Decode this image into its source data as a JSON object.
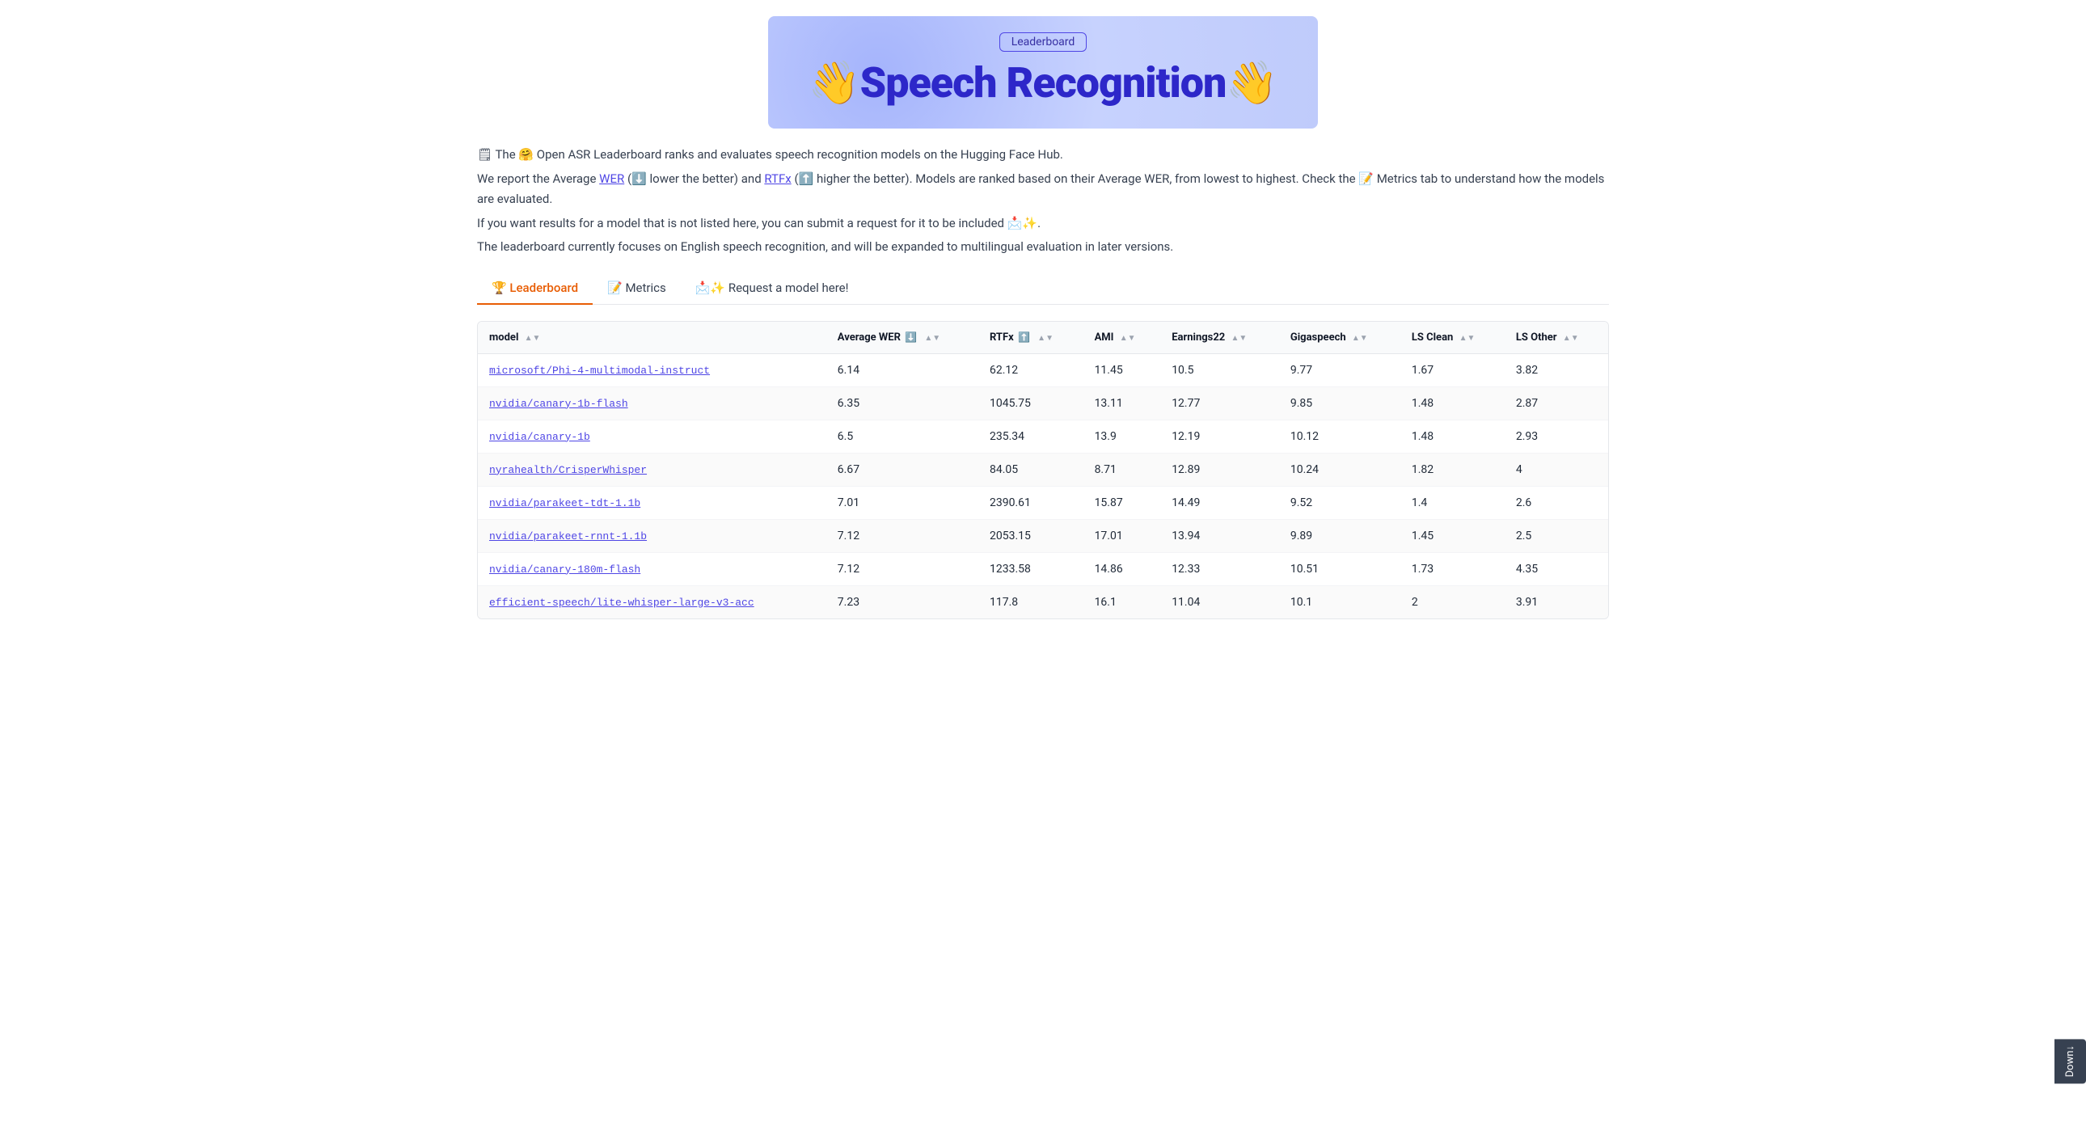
{
  "banner": {
    "button_label": "Leaderboard",
    "title_emoji_left": "👋",
    "title": "Speech Recognition",
    "title_emoji_right": "👋"
  },
  "description": {
    "line1": "🤗 Open ASR Leaderboard ranks and evaluates speech recognition models on the Hugging Face Hub.",
    "line2_prefix": "We report the Average ",
    "wer_link": "WER",
    "line2_mid1": " (⬇️ lower the better) and ",
    "rtfx_link": "RTFx",
    "line2_mid2": " (⬆️ higher the better). Models are ranked based on their Average WER, from lowest to highest. Check the 📝 Metrics tab to understand how the models are evaluated.",
    "line3": "If you want results for a model that is not listed here, you can submit a request for it to be included 📩✨.",
    "line4": "The leaderboard currently focuses on English speech recognition, and will be expanded to multilingual evaluation in later versions."
  },
  "tabs": [
    {
      "id": "leaderboard",
      "label": "🏆 Leaderboard",
      "active": true
    },
    {
      "id": "metrics",
      "label": "📝 Metrics",
      "active": false
    },
    {
      "id": "request",
      "label": "📩✨ Request a model here!",
      "active": false
    }
  ],
  "table": {
    "columns": [
      {
        "id": "model",
        "label": "model",
        "has_sort": true
      },
      {
        "id": "avg_wer",
        "label": "Average WER",
        "icon": "⬇️",
        "has_sort": true
      },
      {
        "id": "rtfx",
        "label": "RTFx",
        "icon": "⬆️",
        "has_sort": true
      },
      {
        "id": "ami",
        "label": "AMI",
        "has_sort": true
      },
      {
        "id": "earnings22",
        "label": "Earnings22",
        "has_sort": true
      },
      {
        "id": "gigaspeech",
        "label": "Gigaspeech",
        "has_sort": true
      },
      {
        "id": "ls_clean",
        "label": "LS Clean",
        "has_sort": true
      },
      {
        "id": "ls_other",
        "label": "LS Other",
        "has_sort": true
      }
    ],
    "rows": [
      {
        "model": "microsoft/Phi-4-multimodal-instruct",
        "avg_wer": "6.14",
        "rtfx": "62.12",
        "ami": "11.45",
        "earnings22": "10.5",
        "gigaspeech": "9.77",
        "ls_clean": "1.67",
        "ls_other": "3.82"
      },
      {
        "model": "nvidia/canary-1b-flash",
        "avg_wer": "6.35",
        "rtfx": "1045.75",
        "ami": "13.11",
        "earnings22": "12.77",
        "gigaspeech": "9.85",
        "ls_clean": "1.48",
        "ls_other": "2.87"
      },
      {
        "model": "nvidia/canary-1b",
        "avg_wer": "6.5",
        "rtfx": "235.34",
        "ami": "13.9",
        "earnings22": "12.19",
        "gigaspeech": "10.12",
        "ls_clean": "1.48",
        "ls_other": "2.93"
      },
      {
        "model": "nyrahealth/CrisperWhisper",
        "avg_wer": "6.67",
        "rtfx": "84.05",
        "ami": "8.71",
        "earnings22": "12.89",
        "gigaspeech": "10.24",
        "ls_clean": "1.82",
        "ls_other": "4"
      },
      {
        "model": "nvidia/parakeet-tdt-1.1b",
        "avg_wer": "7.01",
        "rtfx": "2390.61",
        "ami": "15.87",
        "earnings22": "14.49",
        "gigaspeech": "9.52",
        "ls_clean": "1.4",
        "ls_other": "2.6"
      },
      {
        "model": "nvidia/parakeet-rnnt-1.1b",
        "avg_wer": "7.12",
        "rtfx": "2053.15",
        "ami": "17.01",
        "earnings22": "13.94",
        "gigaspeech": "9.89",
        "ls_clean": "1.45",
        "ls_other": "2.5"
      },
      {
        "model": "nvidia/canary-180m-flash",
        "avg_wer": "7.12",
        "rtfx": "1233.58",
        "ami": "14.86",
        "earnings22": "12.33",
        "gigaspeech": "10.51",
        "ls_clean": "1.73",
        "ls_other": "4.35"
      },
      {
        "model": "efficient-speech/lite-whisper-large-v3-acc",
        "avg_wer": "7.23",
        "rtfx": "117.8",
        "ami": "16.1",
        "earnings22": "11.04",
        "gigaspeech": "10.1",
        "ls_clean": "2",
        "ls_other": "3.91"
      }
    ]
  },
  "download_button": "Down↓"
}
